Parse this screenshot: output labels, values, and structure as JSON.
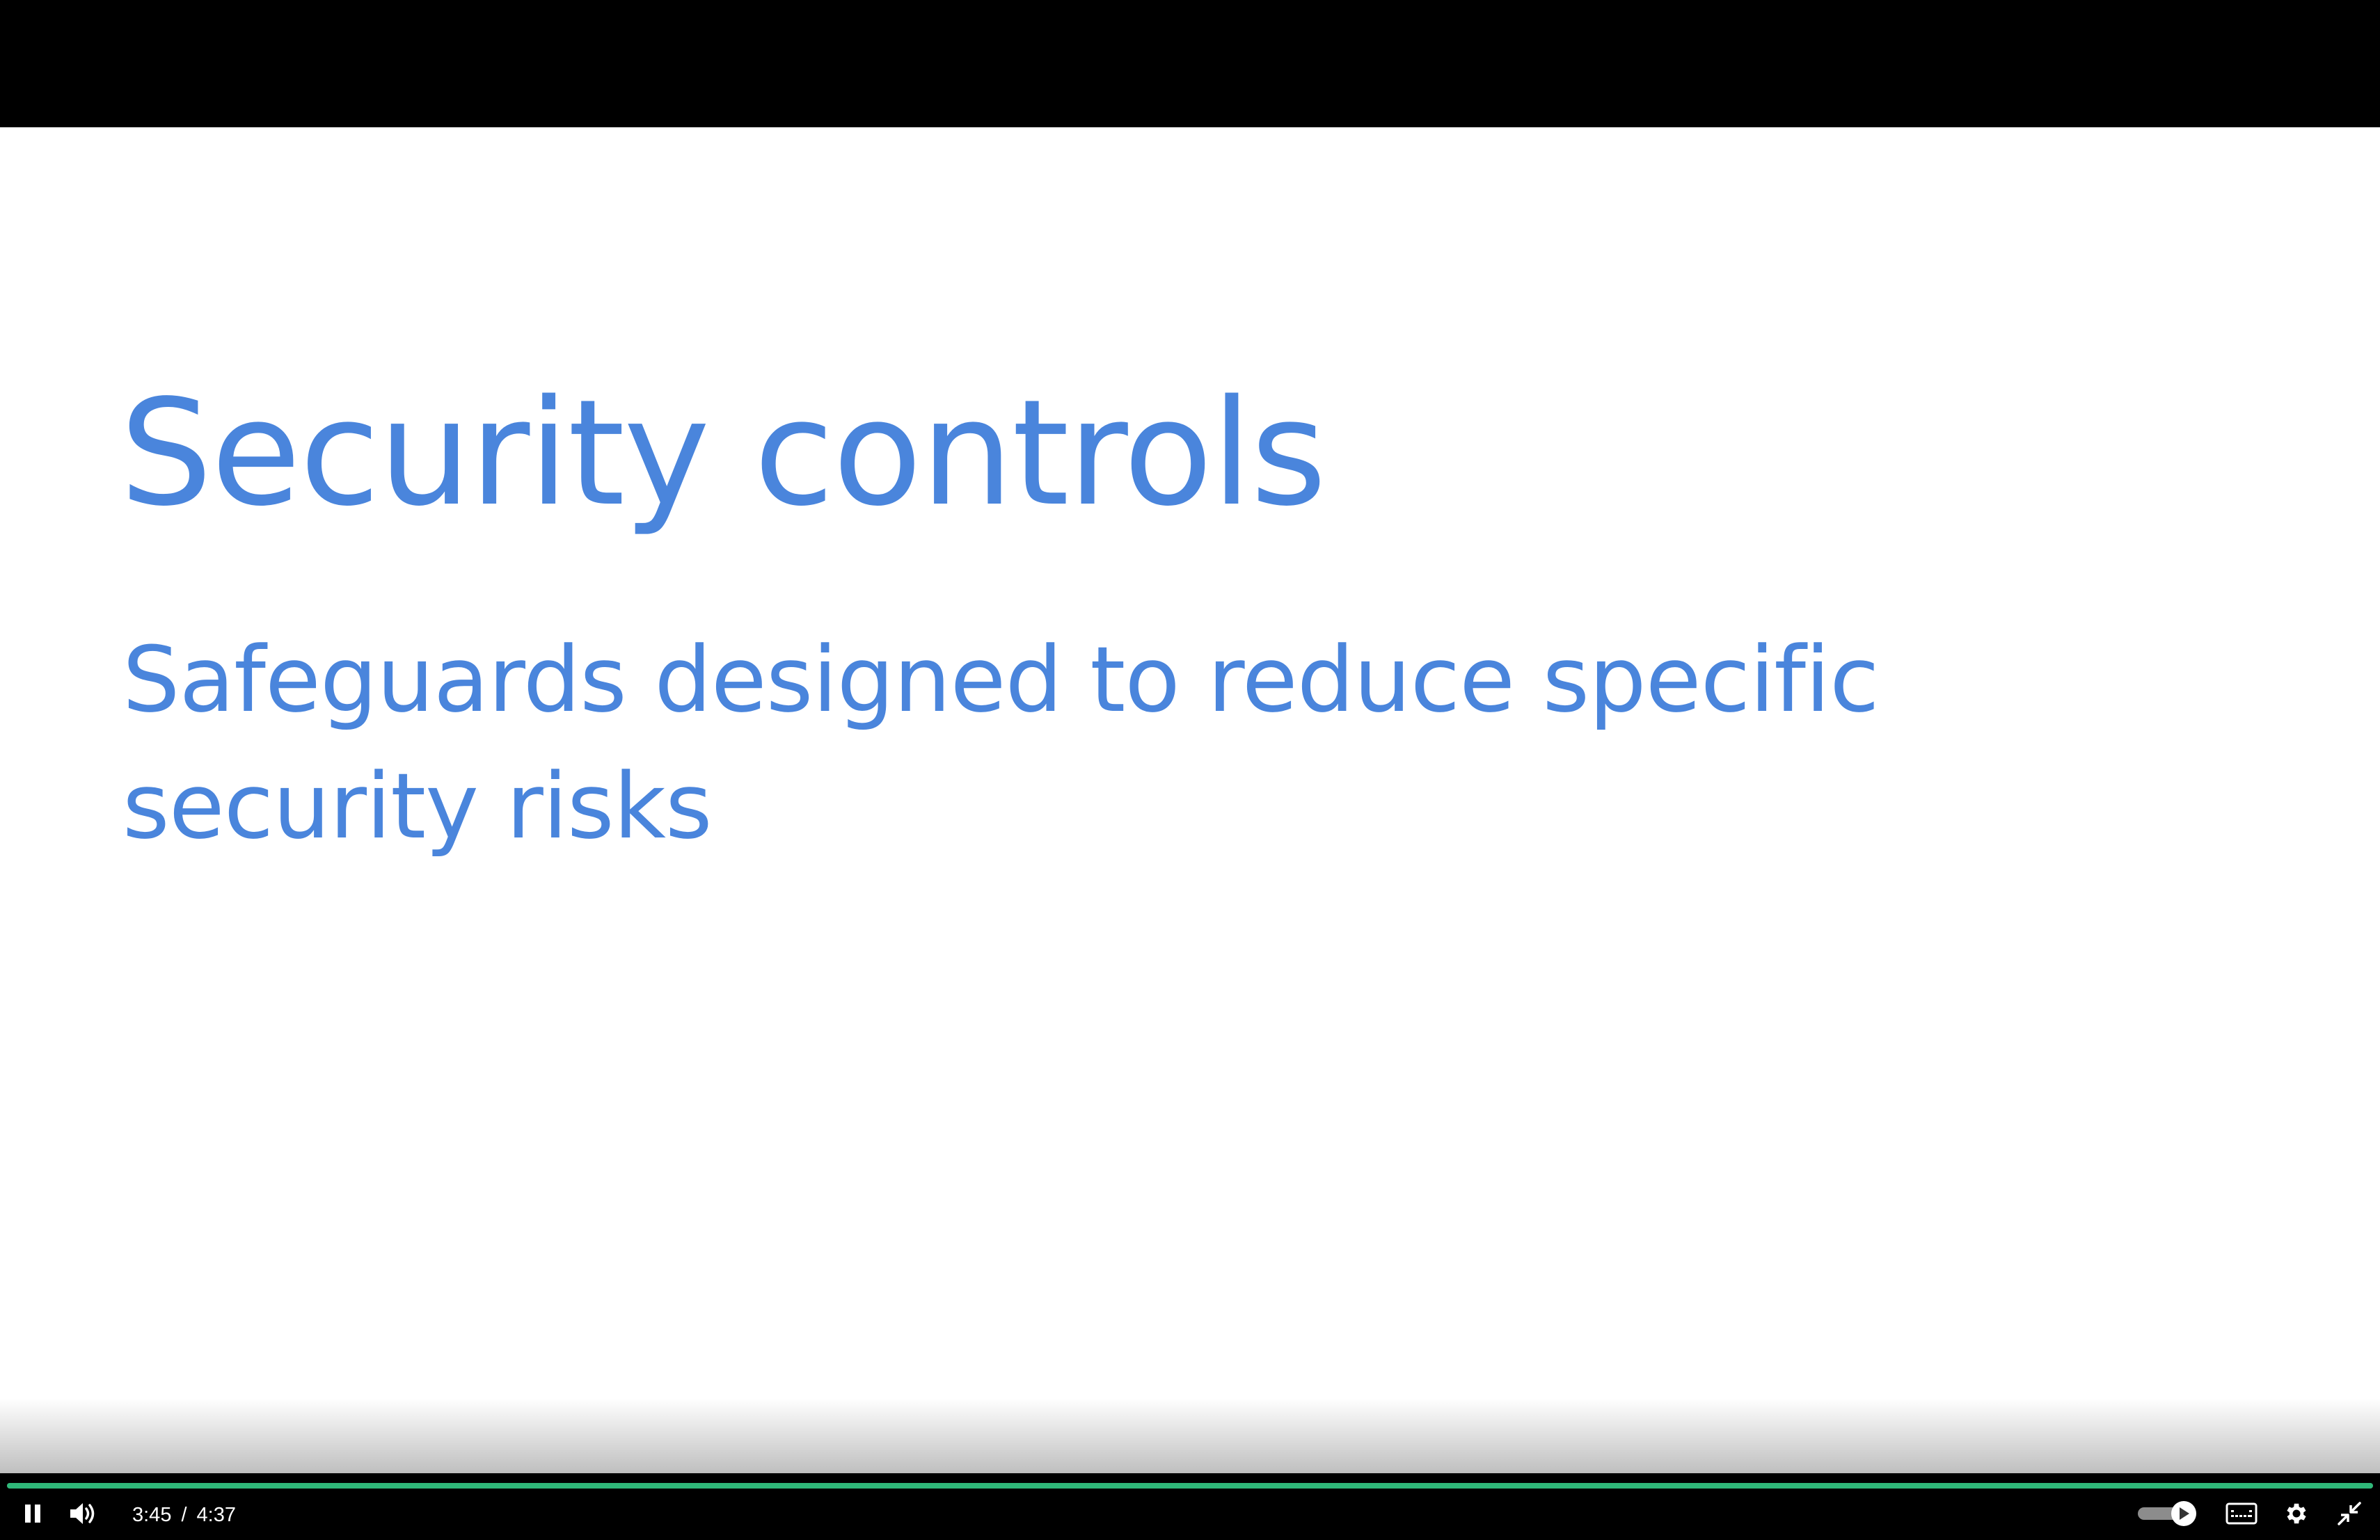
{
  "slide": {
    "title": "Security controls",
    "subtitle": "Safeguards designed to reduce specific security risks"
  },
  "player": {
    "current_time": "3:45",
    "separator": "/",
    "duration": "4:37",
    "progress_fraction": 1.0,
    "autoplay_on": true
  },
  "icons": {
    "play_pause": "pause-icon",
    "volume": "volume-icon",
    "autoplay": "autoplay-toggle-icon",
    "captions": "captions-icon",
    "settings": "gear-icon",
    "fullscreen": "exit-fullscreen-icon"
  },
  "colors": {
    "slide_text": "#4a85dc",
    "progress": "#2fb879"
  }
}
